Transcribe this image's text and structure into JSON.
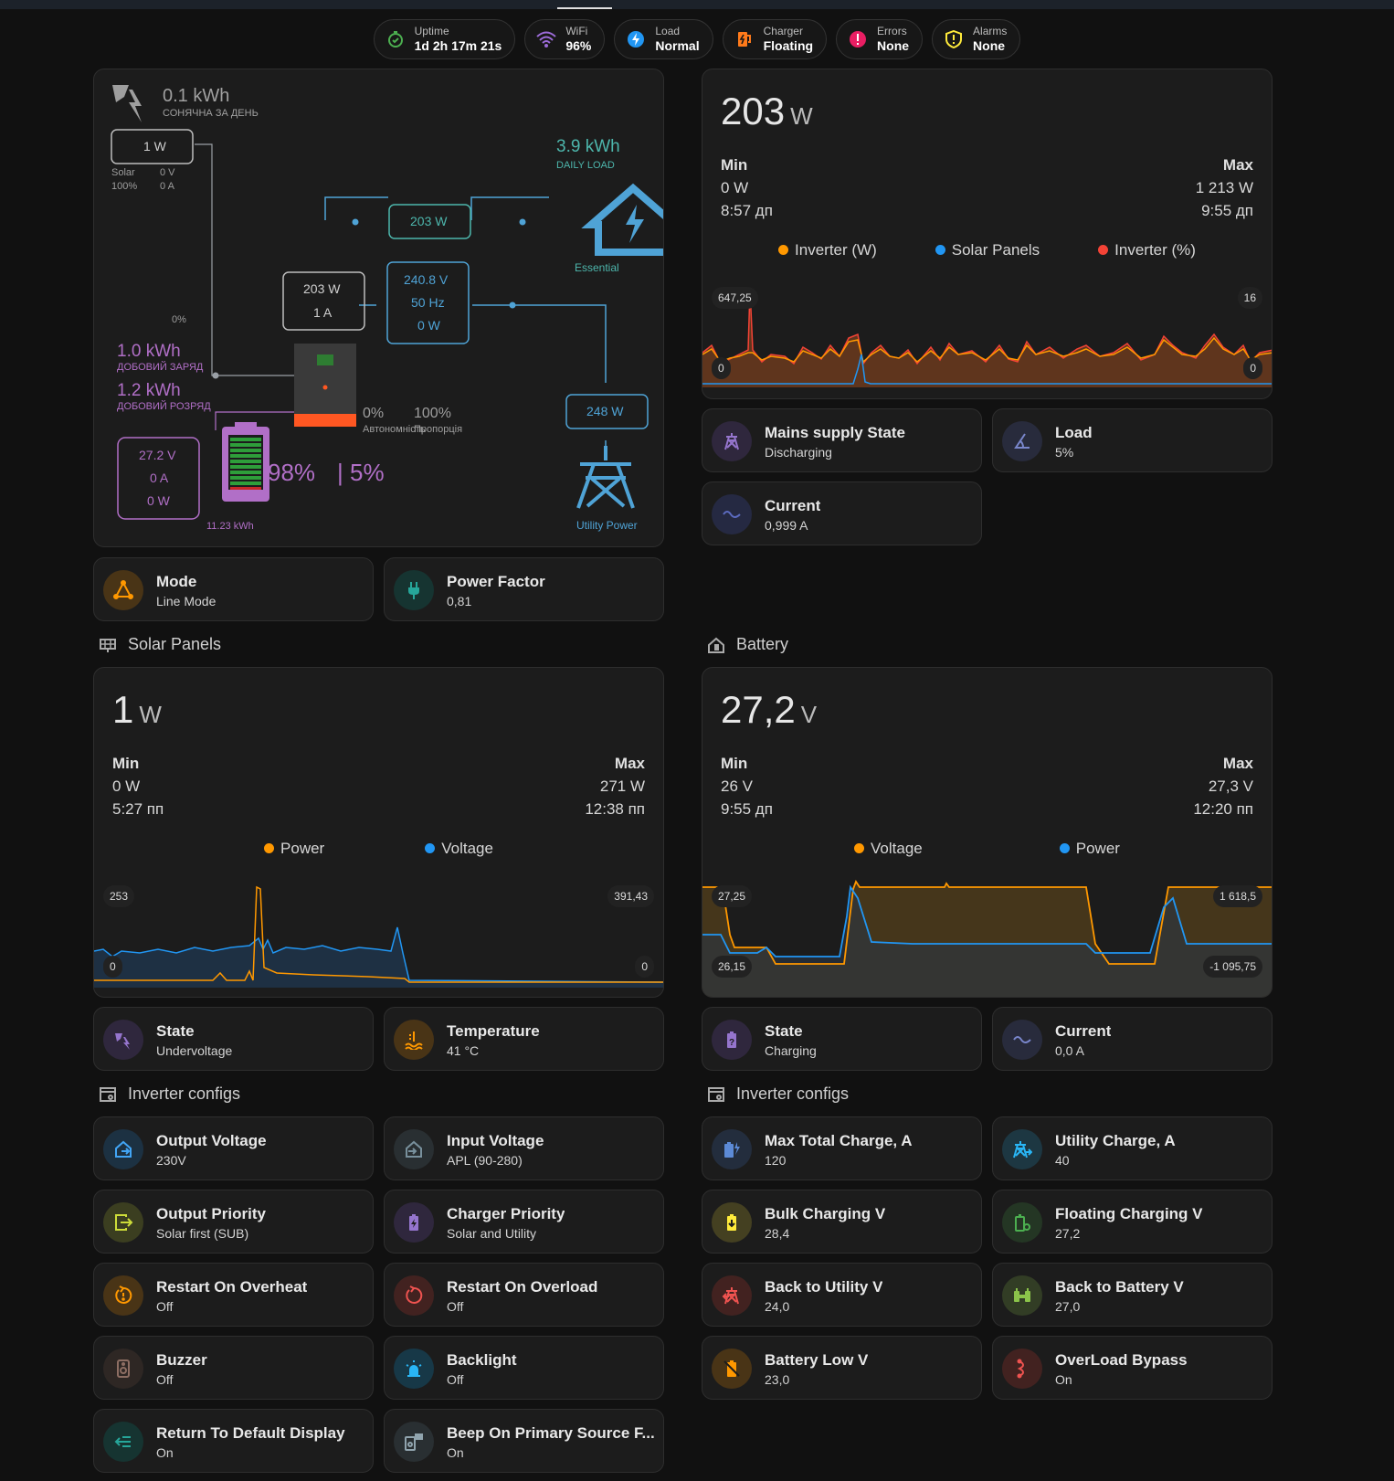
{
  "chips": [
    {
      "name": "Uptime",
      "value": "1d 2h 17m 21s",
      "icon": "timer-check-icon",
      "color": "#4caf50"
    },
    {
      "name": "WiFi",
      "value": "96%",
      "icon": "wifi-icon",
      "color": "#9c6bd8"
    },
    {
      "name": "Load",
      "value": "Normal",
      "icon": "lightning-circle-icon",
      "color": "#2196f3"
    },
    {
      "name": "Charger",
      "value": "Floating",
      "icon": "charger-icon",
      "color": "#ff7a1a"
    },
    {
      "name": "Errors",
      "value": "None",
      "icon": "alert-circle-icon",
      "color": "#e91e63"
    },
    {
      "name": "Alarms",
      "value": "None",
      "icon": "shield-alert-icon",
      "color": "#ffeb3b"
    }
  ],
  "flow": {
    "solar_today": "0.1 kWh",
    "solar_today_label": "СОНЯЧНА ЗА ДЕНЬ",
    "solar_power": "1 W",
    "solar_label": "Solar",
    "solar_pct": "100%",
    "solar_voltage": "0 V",
    "solar_current": "0 A",
    "daily_load": "3.9 kWh",
    "daily_load_label": "DAILY LOAD",
    "essential_power": "203 W",
    "essential_label": "Essential",
    "inverter_power": "203 W",
    "inverter_current": "1 A",
    "grid_voltage": "240.8 V",
    "grid_freq": "50 Hz",
    "grid_power_inv": "0 W",
    "zero_pct": "0%",
    "daily_charge": "1.0 kWh",
    "daily_charge_label": "ДОБОВИЙ ЗАРЯД",
    "daily_discharge": "1.2 kWh",
    "daily_discharge_label": "ДОБОВИЙ РОЗРЯД",
    "autonomy_pct": "0%",
    "autonomy_label": "Автономність",
    "ratio_pct": "100%",
    "ratio_label": "Пропорція",
    "utility_power": "248 W",
    "utility_label": "Utility Power",
    "bat_voltage": "27.2 V",
    "bat_current": "0 A",
    "bat_power": "0 W",
    "bat_capacity": "11.23 kWh",
    "bat_soc": "98%",
    "bat_soc2": "| 5%"
  },
  "inverter_graph": {
    "value": "203",
    "unit": "W",
    "min_label": "Min",
    "max_label": "Max",
    "min_value": "0 W",
    "min_time": "8:57 дп",
    "max_value": "1 213 W",
    "max_time": "9:55 дп",
    "legend": [
      {
        "name": "Inverter (W)",
        "color": "#ff9800"
      },
      {
        "name": "Solar Panels",
        "color": "#2196f3"
      },
      {
        "name": "Inverter (%)",
        "color": "#f44336"
      }
    ],
    "axis_left_top": "647,25",
    "axis_left_bottom": "0",
    "axis_right_top": "16",
    "axis_right_bottom": "0"
  },
  "right_tiles": [
    {
      "name": "Mains supply State",
      "state": "Discharging",
      "icon": "transmission-tower-icon",
      "color": "#7e57c2"
    },
    {
      "name": "Load",
      "state": "5%",
      "icon": "angle-icon",
      "color": "#5c6bc0"
    },
    {
      "name": "Current",
      "state": "0,999 A",
      "icon": "sine-wave-icon",
      "color": "#3f51b5"
    }
  ],
  "left_tiles": [
    {
      "name": "Mode",
      "state": "Line Mode",
      "icon": "triangle-nodes-icon",
      "color": "#ff9800"
    },
    {
      "name": "Power Factor",
      "state": "0,81",
      "icon": "power-plug-icon",
      "color": "#009688"
    }
  ],
  "sections": {
    "solar": "Solar Panels",
    "battery": "Battery",
    "configs_left": "Inverter configs",
    "configs_right": "Inverter configs"
  },
  "solar_graph": {
    "value": "1",
    "unit": "W",
    "min_label": "Min",
    "max_label": "Max",
    "min_value": "0 W",
    "min_time": "5:27 пп",
    "max_value": "271 W",
    "max_time": "12:38 пп",
    "legend": [
      {
        "name": "Power",
        "color": "#ff9800"
      },
      {
        "name": "Voltage",
        "color": "#2196f3"
      }
    ],
    "axis_left_top": "253",
    "axis_left_bottom": "0",
    "axis_right_top": "391,43",
    "axis_right_bottom": "0"
  },
  "battery_graph": {
    "value": "27,2",
    "unit": "V",
    "min_label": "Min",
    "max_label": "Max",
    "min_value": "26 V",
    "min_time": "9:55 дп",
    "max_value": "27,3 V",
    "max_time": "12:20 пп",
    "legend": [
      {
        "name": "Voltage",
        "color": "#ff9800"
      },
      {
        "name": "Power",
        "color": "#2196f3"
      }
    ],
    "axis_left_top": "27,25",
    "axis_left_bottom": "26,15",
    "axis_right_top": "1 618,5",
    "axis_right_bottom": "-1 095,75"
  },
  "solar_tiles": [
    {
      "name": "State",
      "state": "Undervoltage",
      "icon": "solar-power-icon",
      "color": "#7e57c2"
    },
    {
      "name": "Temperature",
      "state": "41 °C",
      "icon": "thermometer-water-icon",
      "color": "#ff9800"
    }
  ],
  "battery_tiles": [
    {
      "name": "State",
      "state": "Charging",
      "icon": "battery-unknown-icon",
      "color": "#7e57c2"
    },
    {
      "name": "Current",
      "state": "0,0 A",
      "icon": "sine-wave-icon",
      "color": "#5c6bc0"
    }
  ],
  "config_left": [
    {
      "name": "Output Voltage",
      "state": "230V",
      "icon": "home-export-icon",
      "color": "#2196f3"
    },
    {
      "name": "Input Voltage",
      "state": "APL (90-280)",
      "icon": "home-import-icon",
      "color": "#607d8b"
    },
    {
      "name": "Output Priority",
      "state": "Solar first (SUB)",
      "icon": "export-icon",
      "color": "#cddc39"
    },
    {
      "name": "Charger Priority",
      "state": "Solar and Utility",
      "icon": "battery-charging-icon",
      "color": "#7e57c2"
    },
    {
      "name": "Restart On Overheat",
      "state": "Off",
      "icon": "restart-alert-icon",
      "color": "#ff9800"
    },
    {
      "name": "Restart On Overload",
      "state": "Off",
      "icon": "restart-icon",
      "color": "#f44336"
    },
    {
      "name": "Buzzer",
      "state": "Off",
      "icon": "speaker-icon",
      "color": "#795548"
    },
    {
      "name": "Backlight",
      "state": "Off",
      "icon": "alarm-light-icon",
      "color": "#03a9f4"
    },
    {
      "name": "Return To Default Display",
      "state": "On",
      "icon": "keyboard-return-icon",
      "color": "#009688"
    },
    {
      "name": "Beep On Primary Source F...",
      "state": "On",
      "icon": "speaker-message-icon",
      "color": "#607d8b"
    }
  ],
  "config_right": [
    {
      "name": "Max Total Charge, A",
      "state": "120",
      "icon": "battery-charging-high-icon",
      "color": "#3f6fb5"
    },
    {
      "name": "Utility Charge, A",
      "state": "40",
      "icon": "transmission-tower-import-icon",
      "color": "#29b6f6"
    },
    {
      "name": "Bulk Charging V",
      "state": "28,4",
      "icon": "battery-arrow-down-icon",
      "color": "#ffeb3b"
    },
    {
      "name": "Floating Charging V",
      "state": "27,2",
      "icon": "battery-sync-icon",
      "color": "#4caf50"
    },
    {
      "name": "Back to Utility V",
      "state": "24,0",
      "icon": "transmission-tower-off-icon",
      "color": "#f44336"
    },
    {
      "name": "Back to Battery V",
      "state": "27,0",
      "icon": "battery-charging-outline-icon",
      "color": "#8bc34a"
    },
    {
      "name": "Battery Low V",
      "state": "23,0",
      "icon": "battery-off-icon",
      "color": "#ff9800"
    },
    {
      "name": "OverLoad Bypass",
      "state": "On",
      "icon": "current-ac-bypass-icon",
      "color": "#f44336"
    }
  ]
}
